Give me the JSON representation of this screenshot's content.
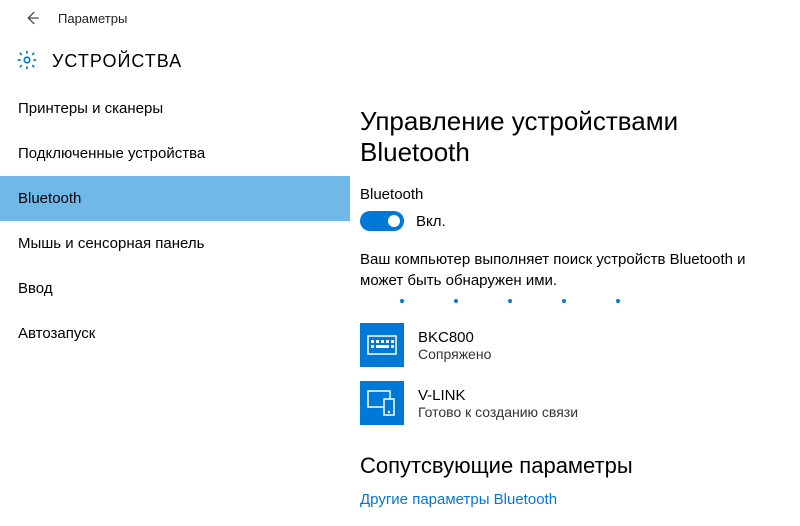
{
  "app_title": "Параметры",
  "page_title": "УСТРОЙСТВА",
  "sidebar": {
    "items": [
      {
        "label": "Принтеры и сканеры"
      },
      {
        "label": "Подключенные устройства"
      },
      {
        "label": "Bluetooth"
      },
      {
        "label": "Мышь и сенсорная панель"
      },
      {
        "label": "Ввод"
      },
      {
        "label": "Автозапуск"
      }
    ],
    "selected_index": 2
  },
  "content": {
    "heading": "Управление устройствами Bluetooth",
    "toggle_label": "Bluetooth",
    "toggle_state": "Вкл.",
    "description": "Ваш компьютер выполняет поиск устройств Bluetooth и может быть обнаружен ими.",
    "devices": [
      {
        "icon": "keyboard-icon",
        "name": "BKC800",
        "status": "Сопряжено"
      },
      {
        "icon": "devices-icon",
        "name": "V-LINK",
        "status": "Готово к созданию связи"
      }
    ],
    "related_heading": "Сопутсвующие параметры",
    "related_link": "Другие параметры Bluetooth"
  }
}
